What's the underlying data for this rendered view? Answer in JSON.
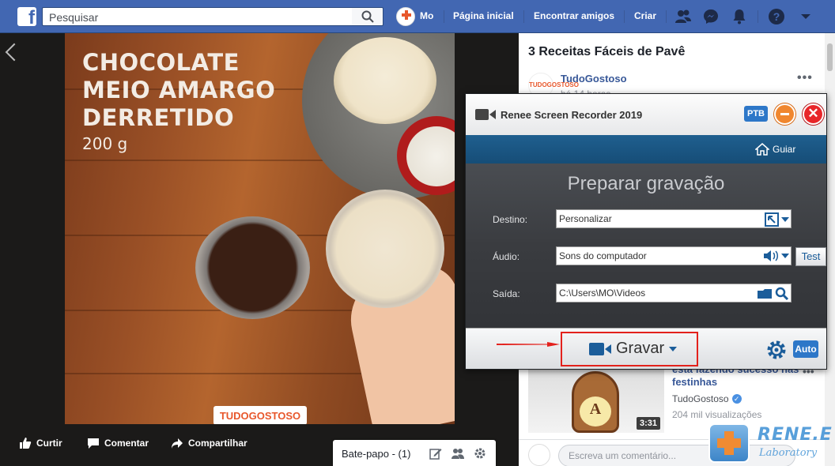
{
  "facebook": {
    "search_placeholder": "Pesquisar",
    "user_name": "Mo",
    "nav": [
      "Página inicial",
      "Encontrar amigos",
      "Criar"
    ],
    "video": {
      "overlay_title_lines": [
        "CHOCOLATE",
        "MEIO AMARGO",
        "DERRETIDO"
      ],
      "overlay_weight": "200 g",
      "watermark": "TUDOGOSTOSO"
    },
    "actions": {
      "like": "Curtir",
      "comment": "Comentar",
      "share": "Compartilhar"
    },
    "chat": {
      "label": "Bate-papo - (1)"
    },
    "post": {
      "title": "3 Receitas Fáceis de Pavê",
      "page_name": "TudoGostoso",
      "page_logo_text": "TUDOGOSTOSO",
      "time": "há 14 horas"
    },
    "recommended": {
      "title": "está fazendo sucesso nas festinhas",
      "author": "TudoGostoso",
      "views": "204 mil visualizações",
      "duration": "3:31",
      "thumb_letter": "A"
    },
    "comment_placeholder": "Escreva um comentário..."
  },
  "recorder": {
    "title": "Renee Screen Recorder 2019",
    "lang_button": "PTB",
    "guide_label": "Guiar",
    "heading": "Preparar gravação",
    "fields": {
      "destination_label": "Destino:",
      "destination_value": "Personalizar",
      "audio_label": "Áudio:",
      "audio_value": "Sons do computador",
      "output_label": "Saída:",
      "output_value": "C:\\Users\\MO\\Videos"
    },
    "test_button": "Test",
    "record_button": "Gravar",
    "auto_button": "Auto"
  },
  "watermark": {
    "brand": "RENE.E",
    "sub": "Laboratory"
  },
  "colors": {
    "facebook_blue": "#4267b2",
    "recorder_toolbar": "#1f5f8f",
    "highlight_red": "#e3211c",
    "accent_blue": "#2d77c8"
  }
}
